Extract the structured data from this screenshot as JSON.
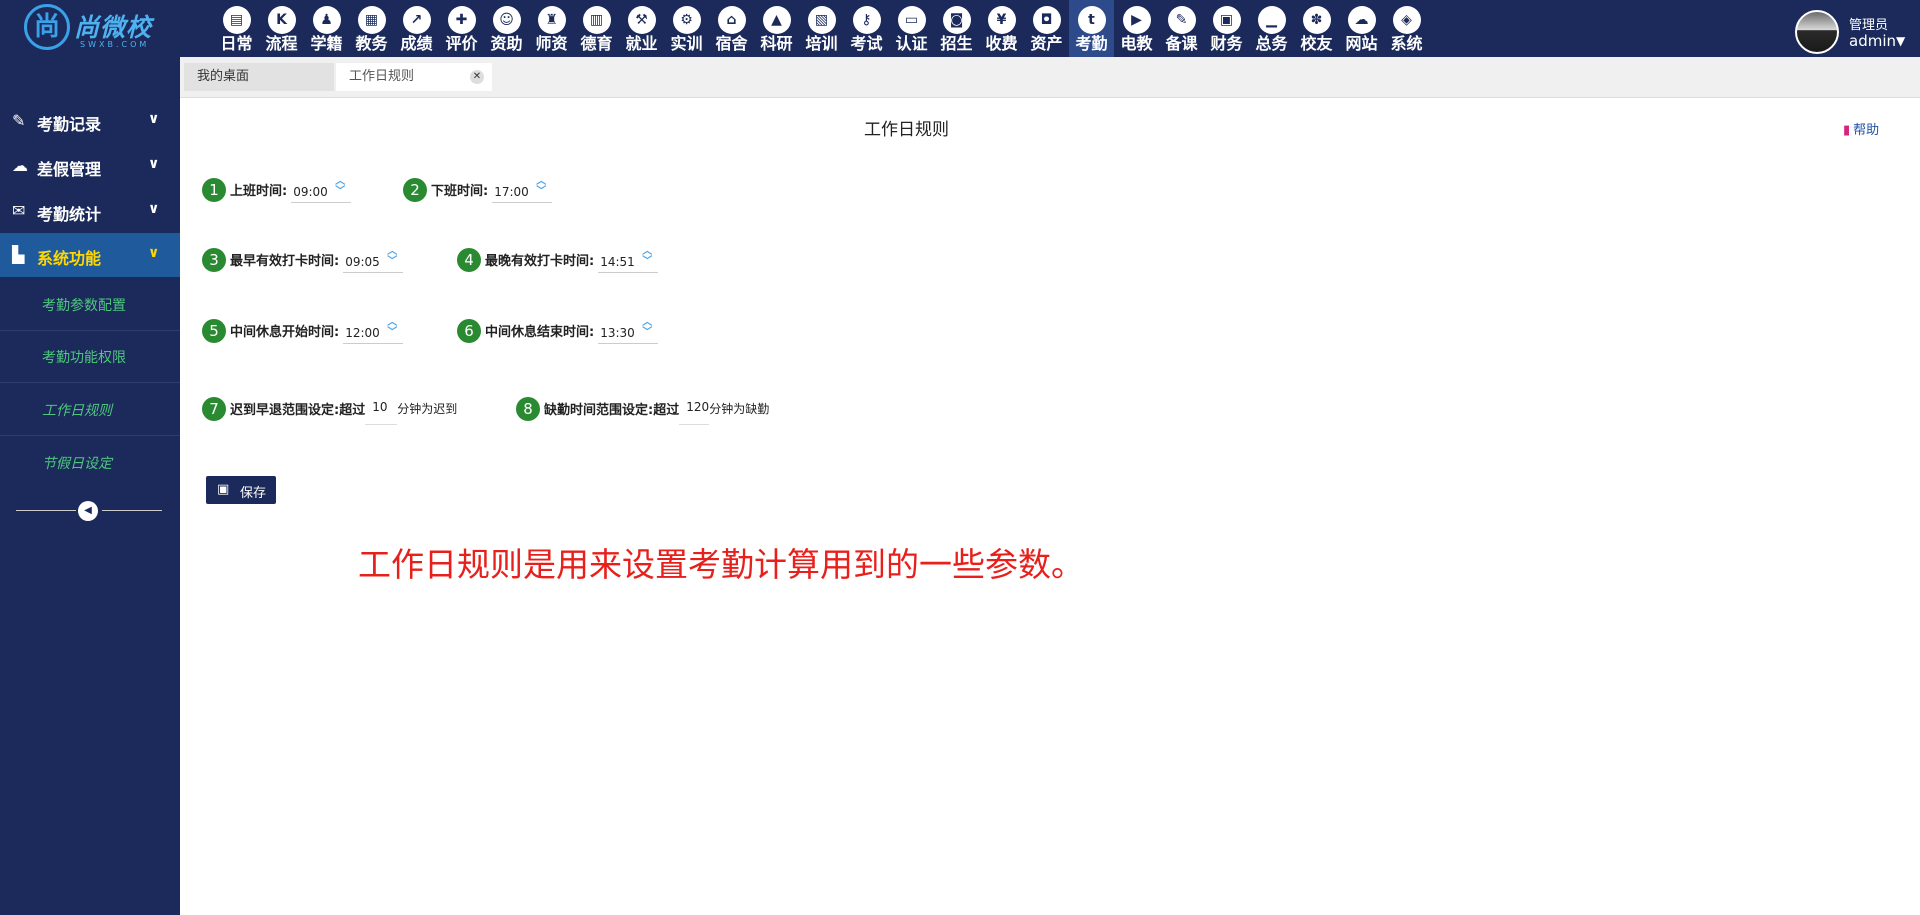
{
  "brand": {
    "logo_glyph": "尚",
    "name": "尚微校",
    "sub": "SWXB.COM"
  },
  "nav": [
    {
      "label": "日常",
      "icon": "document-icon",
      "glyph": "▤"
    },
    {
      "label": "流程",
      "icon": "flow-icon",
      "glyph": "K"
    },
    {
      "label": "学籍",
      "icon": "student-icon",
      "glyph": "♟"
    },
    {
      "label": "教务",
      "icon": "calendar-icon",
      "glyph": "▦"
    },
    {
      "label": "成绩",
      "icon": "trend-icon",
      "glyph": "↗"
    },
    {
      "label": "评价",
      "icon": "calendar-plus-icon",
      "glyph": "✚"
    },
    {
      "label": "资助",
      "icon": "person-icon",
      "glyph": "☺"
    },
    {
      "label": "师资",
      "icon": "teacher-icon",
      "glyph": "♜"
    },
    {
      "label": "德育",
      "icon": "book-icon",
      "glyph": "▥"
    },
    {
      "label": "就业",
      "icon": "hammer-icon",
      "glyph": "⚒"
    },
    {
      "label": "实训",
      "icon": "tools-icon",
      "glyph": "⚙"
    },
    {
      "label": "宿舍",
      "icon": "home-icon",
      "glyph": "⌂"
    },
    {
      "label": "科研",
      "icon": "graduation-cap-icon",
      "glyph": "▲"
    },
    {
      "label": "培训",
      "icon": "image-icon",
      "glyph": "▧"
    },
    {
      "label": "考试",
      "icon": "key-icon",
      "glyph": "⚷"
    },
    {
      "label": "认证",
      "icon": "monitor-icon",
      "glyph": "▭"
    },
    {
      "label": "招生",
      "icon": "bus-icon",
      "glyph": "◙"
    },
    {
      "label": "收费",
      "icon": "yen-icon",
      "glyph": "¥"
    },
    {
      "label": "资产",
      "icon": "train-icon",
      "glyph": "◘"
    },
    {
      "label": "考勤",
      "icon": "tumblr-icon",
      "glyph": "t",
      "active": true
    },
    {
      "label": "电教",
      "icon": "video-file-icon",
      "glyph": "▶"
    },
    {
      "label": "备课",
      "icon": "edit-icon",
      "glyph": "✎"
    },
    {
      "label": "财务",
      "icon": "newspaper-icon",
      "glyph": "▣"
    },
    {
      "label": "总务",
      "icon": "bar-chart-icon",
      "glyph": "▁"
    },
    {
      "label": "校友",
      "icon": "group-icon",
      "glyph": "✽"
    },
    {
      "label": "网站",
      "icon": "cloud-icon",
      "glyph": "☁"
    },
    {
      "label": "系统",
      "icon": "cube-icon",
      "glyph": "◈"
    }
  ],
  "user": {
    "role": "管理员",
    "name": "admin"
  },
  "sidebar": {
    "groups": [
      {
        "label": "考勤记录",
        "icon": "book-icon",
        "glyph": "✎"
      },
      {
        "label": "差假管理",
        "icon": "cloud-icon",
        "glyph": "☁"
      },
      {
        "label": "考勤统计",
        "icon": "envelope-icon",
        "glyph": "✉"
      },
      {
        "label": "系统功能",
        "icon": "file-icon",
        "glyph": "▙",
        "active": true
      }
    ],
    "sub_items": [
      {
        "label": "考勤参数配置"
      },
      {
        "label": "考勤功能权限"
      },
      {
        "label": "工作日规则",
        "current": true
      },
      {
        "label": "节假日设定"
      }
    ]
  },
  "tabs": [
    {
      "label": "我的桌面"
    },
    {
      "label": "工作日规则",
      "closable": true
    }
  ],
  "page": {
    "title": "工作日规则",
    "help": "帮助",
    "fields": [
      {
        "num": "1",
        "label": "上班时间:",
        "value": "09:00"
      },
      {
        "num": "2",
        "label": "下班时间:",
        "value": "17:00"
      },
      {
        "num": "3",
        "label": "最早有效打卡时间:",
        "value": "09:05"
      },
      {
        "num": "4",
        "label": "最晚有效打卡时间:",
        "value": "14:51"
      },
      {
        "num": "5",
        "label": "中间休息开始时间:",
        "value": "12:00"
      },
      {
        "num": "6",
        "label": "中间休息结束时间:",
        "value": "13:30"
      }
    ],
    "late": {
      "num": "7",
      "label": "迟到早退范围设定:超过",
      "value": "10",
      "suffix": "分钟为迟到"
    },
    "absent": {
      "num": "8",
      "label": "缺勤时间范围设定:超过",
      "value": "120",
      "suffix": "分钟为缺勤"
    },
    "save": "保存",
    "note": "工作日规则是用来设置考勤计算用到的一些参数。"
  }
}
